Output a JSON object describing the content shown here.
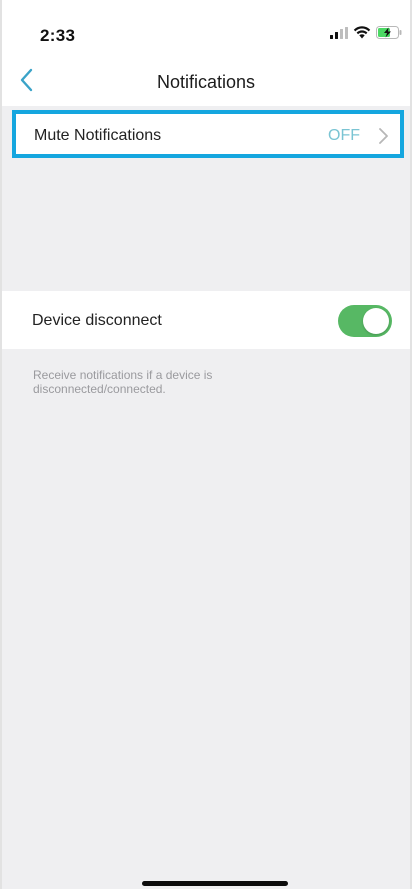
{
  "status_bar": {
    "time": "2:33",
    "icons": [
      "cellular-signal-icon",
      "wifi-icon",
      "battery-charging-icon"
    ]
  },
  "nav": {
    "title": "Notifications",
    "back_icon": "chevron-left-icon"
  },
  "mute_row": {
    "label": "Mute Notifications",
    "value": "OFF",
    "chevron_icon": "chevron-right-icon"
  },
  "device_disconnect": {
    "label": "Device disconnect",
    "toggle_on": true,
    "description": "Receive notifications if a device is disconnected/connected."
  },
  "colors": {
    "accent": "#15a6df",
    "toggle_on": "#57b864",
    "value_text": "#7ac4d3",
    "back_icon": "#3aa3c8"
  }
}
